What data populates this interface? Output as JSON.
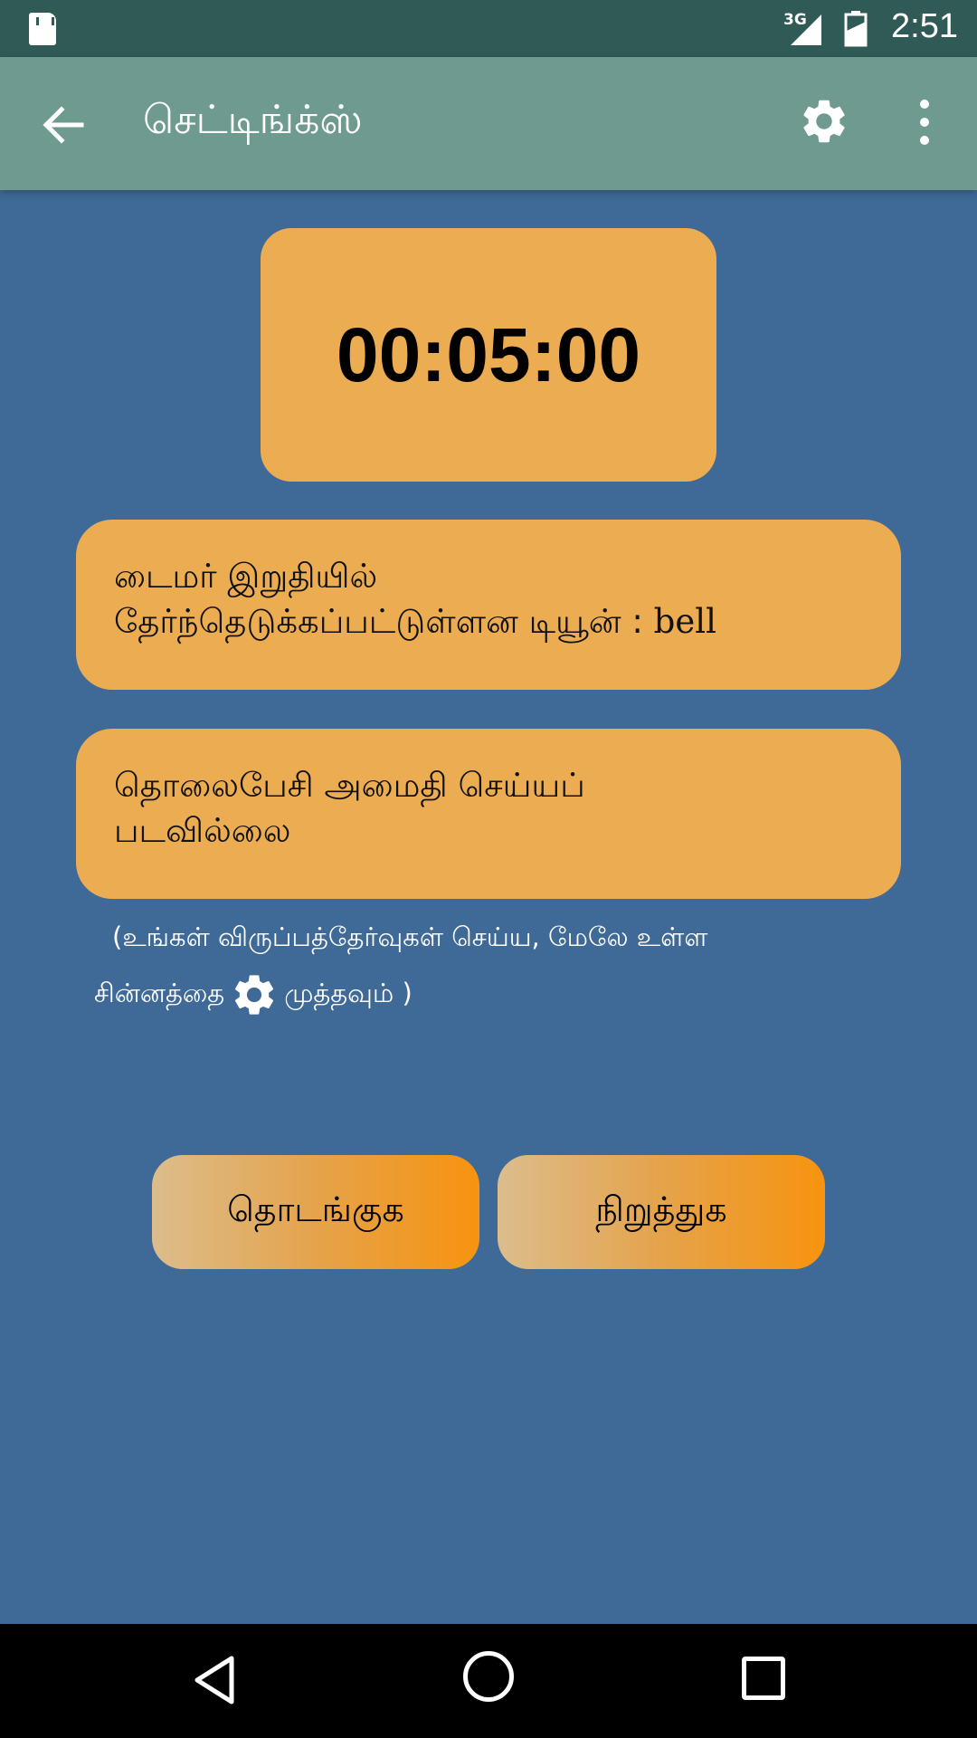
{
  "status_bar": {
    "network": "3G",
    "time": "2:51"
  },
  "app_bar": {
    "title": "செட்டிங்க்ஸ்"
  },
  "timer": {
    "display": "00:05:00"
  },
  "tune_box": {
    "line1": "டைமர் இறுதியில்",
    "line2_prefix": "தேர்ந்தெடுக்கப்பட்டுள்ளன டியூன் : ",
    "line2_value": "bell"
  },
  "silent_box": {
    "line1": "தொலைபேசி அமைதி செய்யப்",
    "line2": "படவில்லை"
  },
  "hint": {
    "line1": "(உங்கள் விருப்பத்தேர்வுகள் செய்ய, மேலே உள்ள",
    "line2_before": "சின்னத்தை",
    "line2_after": "முத்தவும் )"
  },
  "buttons": {
    "start": "தொடங்குக",
    "stop": "நிறுத்துக"
  },
  "colors": {
    "status_bar": "#2f5a56",
    "app_bar": "#6f9a90",
    "background": "#3f6a97",
    "card": "#ecac52",
    "button_start": "#dcbd8c",
    "button_end": "#f7930f"
  }
}
